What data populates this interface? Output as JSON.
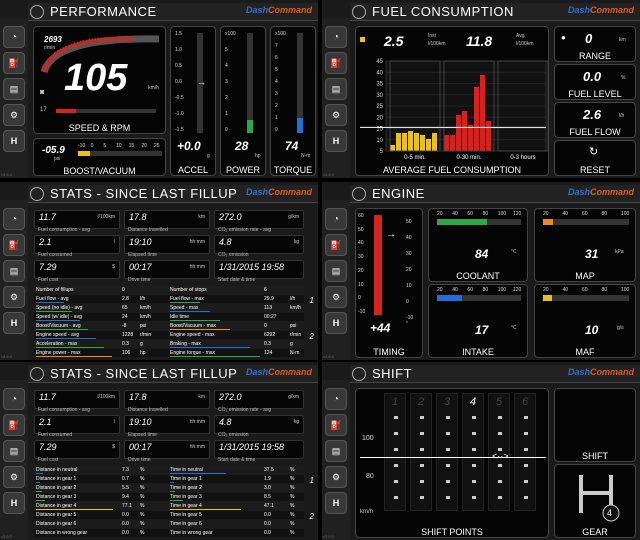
{
  "performance": {
    "title": "PERFORMANCE",
    "rpm": "2693",
    "rpm_unit": "r/min",
    "speed": "105",
    "speed_unit": "km/h",
    "fuel_pct": "17",
    "main_label": "SPEED & RPM",
    "boost": "-05.9",
    "boost_unit": "psi",
    "boost_label": "BOOST/VACUUM",
    "boost_ticks": [
      "-10",
      "0",
      "5",
      "10",
      "15",
      "20",
      "25"
    ],
    "accel": "+0.0",
    "accel_unit": "g",
    "accel_label": "ACCEL",
    "power": "28",
    "power_unit": "hp",
    "power_label": "POWER",
    "torque": "74",
    "torque_unit": "N·m",
    "torque_label": "TORQUE",
    "accel_ticks": [
      "1.5",
      "1.0",
      "0.5",
      "0.0",
      "-0.5",
      "-1.0",
      "-1.5"
    ],
    "power_ticks": [
      "x100",
      "5",
      "4",
      "3",
      "2",
      "1",
      "0"
    ],
    "torque_ticks": [
      "x100",
      "7",
      "6",
      "5",
      "4",
      "3",
      "2",
      "1",
      "0"
    ],
    "power_level": 0.13,
    "torque_level": 0.15
  },
  "fuel": {
    "title": "FUEL CONSUMPTION",
    "inst": "2.5",
    "inst_unit": "l/100km",
    "inst_label": "Inst",
    "avg": "11.8",
    "avg_unit": "l/100km",
    "avg_label": "Avg",
    "y_ticks": [
      "45",
      "40",
      "35",
      "30",
      "25",
      "20",
      "15",
      "10",
      "5"
    ],
    "x_labels": [
      "0-5 min.",
      "0-30 min.",
      "0-3 hours"
    ],
    "label": "AVERAGE FUEL CONSUMPTION",
    "range": "0",
    "range_unit": "km",
    "range_label": "RANGE",
    "level": "0.0",
    "level_unit": "%",
    "level_label": "FUEL LEVEL",
    "flow": "2.6",
    "flow_unit": "l/h",
    "flow_label": "FUEL FLOW",
    "reset_label": "RESET"
  },
  "chart_data": {
    "type": "bar",
    "series": [
      {
        "values": [
          3,
          9,
          9,
          10,
          9,
          8,
          6,
          9
        ]
      },
      {
        "values": [
          8,
          8,
          18,
          20,
          13,
          32,
          38,
          15
        ]
      },
      {
        "values": [
          0,
          0,
          0,
          0,
          0,
          0,
          0,
          0
        ]
      }
    ],
    "categories": [
      "0-5 min.",
      "0-30 min.",
      "0-3 hours"
    ],
    "ylim": [
      0,
      45
    ]
  },
  "stats1": {
    "title": "STATS - SINCE LAST FILLUP",
    "cells": [
      {
        "v": "11.7",
        "u": "l/100km",
        "l": "Fuel consumption - avg"
      },
      {
        "v": "17.8",
        "u": "km",
        "l": "Distance travelled"
      },
      {
        "v": "272.0",
        "u": "g/km",
        "l": "CO₂ emission rate - avg"
      },
      {
        "v": "2.1",
        "u": "l",
        "l": "Fuel consumed"
      },
      {
        "v": "19:10",
        "u": "hh:mm",
        "l": "Elapsed time"
      },
      {
        "v": "4.8",
        "u": "kg",
        "l": "CO₂ emission"
      },
      {
        "v": "7.29",
        "u": "$",
        "l": "Fuel cost"
      },
      {
        "v": "00:17",
        "u": "hh:mm",
        "l": "Drive time"
      },
      {
        "v": "1/31/2015 19:58",
        "u": "",
        "l": "Start date & time"
      }
    ],
    "rows": [
      [
        "Number of fillups",
        "0",
        "",
        "Number of stops",
        "6",
        ""
      ],
      [
        "Fuel flow - avg",
        "2.8",
        "l/h",
        "Fuel flow - max",
        "29.9",
        "l/h"
      ],
      [
        "Speed (no idle) - avg",
        "65",
        "km/h",
        "Speed - max",
        "113",
        "km/h"
      ],
      [
        "Speed (w/ idle) - avg",
        "24",
        "km/h",
        "Idle time",
        "00:27",
        ""
      ],
      [
        "Boost/Vacuum - avg",
        "-8",
        "psi",
        "Boost/Vacuum - max",
        "0",
        "psi"
      ],
      [
        "Engine speed - avg",
        "1228",
        "r/min",
        "Engine speed - max",
        "6292",
        "r/min"
      ],
      [
        "Acceleration - max",
        "0.3",
        "g",
        "Braking - max",
        "0.3",
        "g"
      ],
      [
        "Engine power - max",
        "106",
        "hp",
        "Engine torque - max",
        "124",
        "N·m"
      ]
    ],
    "pages": [
      "1",
      "2"
    ]
  },
  "engine": {
    "title": "ENGINE",
    "timing": "+44",
    "timing_unit": "°",
    "timing_label": "TIMING",
    "timing_ticks": [
      "60",
      "50",
      "40",
      "30",
      "20",
      "10",
      "0",
      "-10"
    ],
    "timing_ticks_r": [
      "50",
      "40",
      "30",
      "20",
      "10",
      "0",
      "-10"
    ],
    "coolant": "84",
    "coolant_unit": "°C",
    "coolant_label": "COOLANT",
    "coolant_ticks": [
      "20",
      "40",
      "60",
      "80",
      "100",
      "120"
    ],
    "map": "31",
    "map_unit": "kPa",
    "map_label": "MAP",
    "map_ticks": [
      "20",
      "40",
      "60",
      "80",
      "100"
    ],
    "intake": "17",
    "intake_unit": "°C",
    "intake_label": "INTAKE",
    "intake_ticks": [
      "20",
      "40",
      "60",
      "80",
      "100",
      "120"
    ],
    "maf": "10",
    "maf_unit": "g/s",
    "maf_label": "MAF",
    "maf_ticks": [
      "20",
      "40",
      "60",
      "80",
      "100"
    ],
    "coolant_level": 0.6,
    "map_level": 0.12,
    "intake_level": 0.3,
    "maf_level": 0.1
  },
  "stats2": {
    "title": "STATS - SINCE LAST FILLUP",
    "cells": [
      {
        "v": "11.7",
        "u": "l/100km",
        "l": "Fuel consumption - avg"
      },
      {
        "v": "17.8",
        "u": "km",
        "l": "Distance travelled"
      },
      {
        "v": "272.0",
        "u": "g/km",
        "l": "CO₂ emission rate - avg"
      },
      {
        "v": "2.1",
        "u": "l",
        "l": "Fuel consumed"
      },
      {
        "v": "19:10",
        "u": "hh:mm",
        "l": "Elapsed time"
      },
      {
        "v": "4.8",
        "u": "kg",
        "l": "CO₂ emission"
      },
      {
        "v": "7.29",
        "u": "$",
        "l": "Fuel cost"
      },
      {
        "v": "00:17",
        "u": "hh:mm",
        "l": "Drive time"
      },
      {
        "v": "1/31/2015 19:58",
        "u": "",
        "l": "Start date & time"
      }
    ],
    "rows": [
      [
        "Distance in neutral",
        "7.3",
        "%",
        "Time in neutral",
        "37.5",
        "%"
      ],
      [
        "Distance in gear 1",
        "0.7",
        "%",
        "Time in gear 1",
        "1.9",
        "%"
      ],
      [
        "Distance in gear 2",
        "5.5",
        "%",
        "Time in gear 2",
        "3.0",
        "%"
      ],
      [
        "Distance in gear 3",
        "9.4",
        "%",
        "Time in gear 3",
        "8.5",
        "%"
      ],
      [
        "Distance in gear 4",
        "77.1",
        "%",
        "Time in gear 4",
        "47.1",
        "%"
      ],
      [
        "Distance in gear 5",
        "0.0",
        "%",
        "Time in gear 5",
        "0.0",
        "%"
      ],
      [
        "Distance in gear 6",
        "0.0",
        "%",
        "Time in gear 6",
        "0.0",
        "%"
      ],
      [
        "Distance in wrong gear",
        "0.0",
        "%",
        "Time in wrong gear",
        "0.0",
        "%"
      ]
    ],
    "pages": [
      "1",
      "2"
    ]
  },
  "shift": {
    "title": "SHIFT",
    "gears": [
      "1",
      "2",
      "3",
      "4",
      "5",
      "6"
    ],
    "active_gear": "4",
    "y_ticks": [
      "100",
      "80"
    ],
    "unit": "km/h",
    "label": "SHIFT POINTS",
    "shift_label": "SHIFT",
    "gear_label": "GEAR",
    "gear_value": "4"
  },
  "logo": {
    "a": "Dash",
    "b": "Command"
  },
  "ver": "v3.6.0",
  "badge": "DASH",
  "colors": {
    "yellow": "#e8c21a",
    "red": "#d4231e",
    "green": "#2aa84a",
    "blue": "#1e6fd6",
    "orange": "#ee8a1a"
  }
}
